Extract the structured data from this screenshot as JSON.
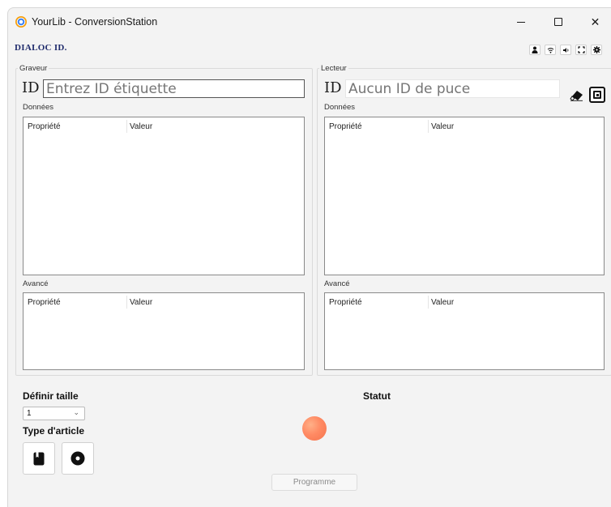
{
  "window": {
    "title": "YourLib - ConversionStation",
    "minimize_label": "",
    "maximize_label": "",
    "close_label": "✕"
  },
  "header": {
    "logo": "DIALOC ID.",
    "toolbar_icons": [
      "user-icon",
      "rfid-waves-icon",
      "speaker-icon",
      "expand-icon",
      "gear-icon"
    ]
  },
  "writer": {
    "legend": "Graveur",
    "id_label": "ID",
    "id_placeholder": "Entrez ID étiquette",
    "data_label": "Données",
    "data_table": {
      "col_property": "Propriété",
      "col_value": "Valeur"
    },
    "advanced_label": "Avancé",
    "advanced_table": {
      "col_property": "Propriété",
      "col_value": "Valeur"
    }
  },
  "reader": {
    "legend": "Lecteur",
    "id_label": "ID",
    "id_placeholder": "Aucun ID de puce",
    "data_label": "Données",
    "data_table": {
      "col_property": "Propriété",
      "col_value": "Valeur"
    },
    "advanced_label": "Avancé",
    "advanced_table": {
      "col_property": "Propriété",
      "col_value": "Valeur"
    }
  },
  "bottom": {
    "size_label": "Définir taille",
    "size_value": "1",
    "type_label": "Type d'article",
    "type_options": [
      "book-icon",
      "disc-icon"
    ],
    "status_label": "Statut",
    "status_color": "#ff8a63",
    "program_label": "Programme"
  }
}
